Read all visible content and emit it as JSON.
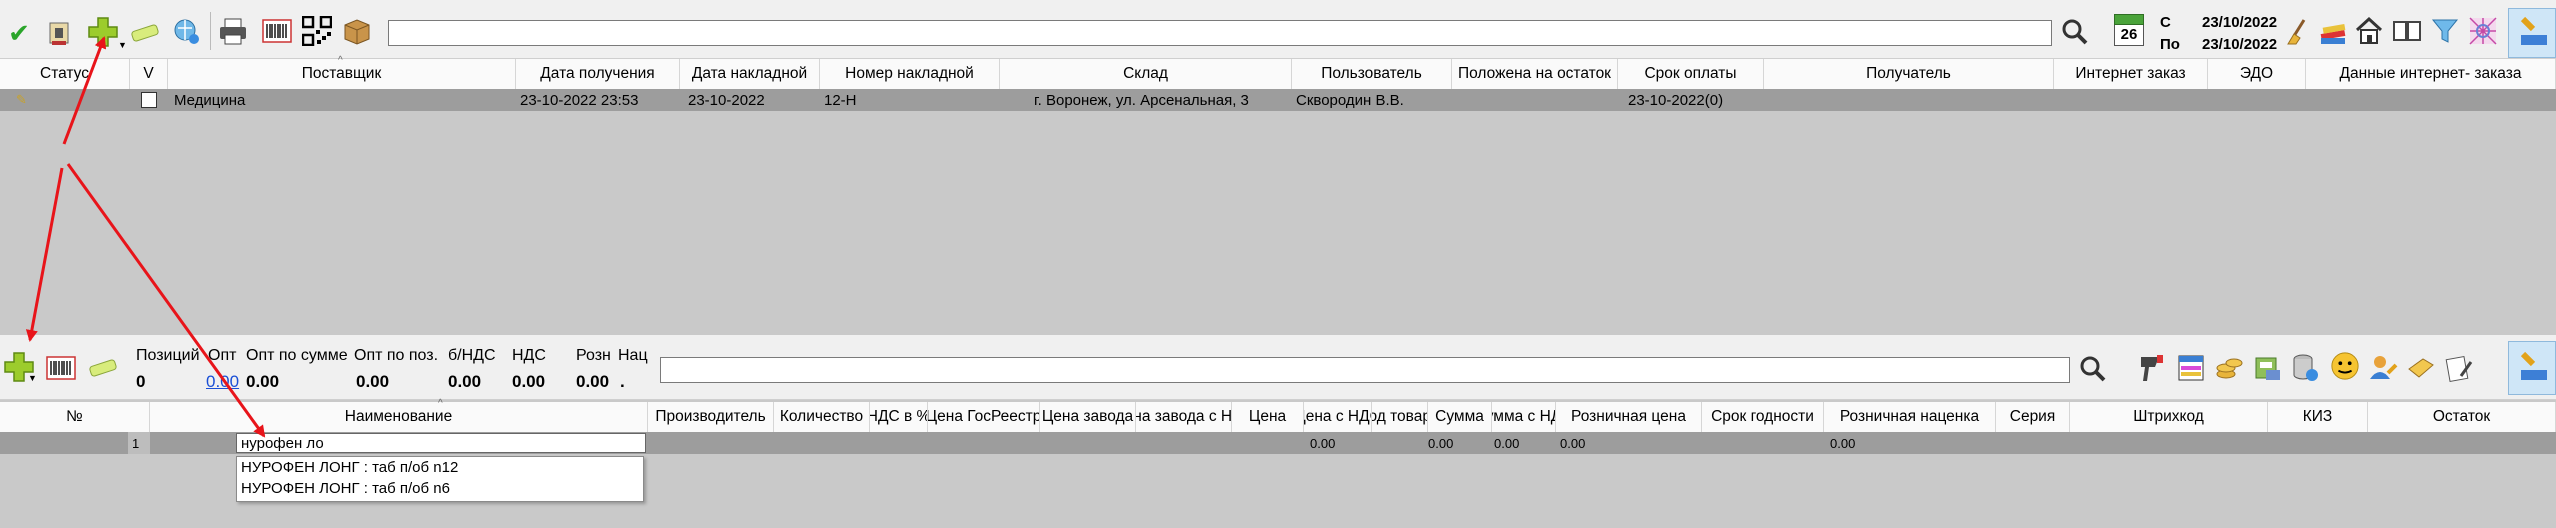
{
  "top_toolbar": {
    "icons": [
      "confirm-check-icon",
      "archive-stamp-icon",
      "add-document-icon",
      "eraser-icon",
      "refresh-globe-icon",
      "print-icon",
      "barcode-icon",
      "qr-code-icon",
      "box-icon"
    ],
    "date_from_label": "С",
    "date_from": "23/10/2022",
    "date_to_label": "По",
    "date_to": "23/10/2022",
    "calendar_day": "26",
    "right_icons": [
      "broom-icon",
      "books-icon",
      "home-icon",
      "book-open-icon",
      "filter-icon",
      "pattern-icon",
      "reports-icon"
    ]
  },
  "invoices_table": {
    "columns": [
      "Статус",
      "V",
      "Поставщик",
      "Дата получения",
      "Дата накладной",
      "Номер накладной",
      "Склад",
      "Пользователь",
      "Положена на остаток",
      "Срок оплаты",
      "Получатель",
      "Интернет заказ",
      "ЭДО",
      "Данные интернет- заказа"
    ],
    "rows": [
      {
        "supplier": "Медицина",
        "received_date": "23-10-2022 23:53",
        "invoice_date": "23-10-2022",
        "invoice_number": "12-Н",
        "warehouse": "г. Воронеж, ул. Арсенальная, 3",
        "user": "Сквородин В.В.",
        "payment_due": "23-10-2022(0)"
      }
    ]
  },
  "summary": {
    "positions_label": "Позиций",
    "positions_value": "0",
    "opt_label": "Опт",
    "opt_value": "0.00",
    "opt_sum_label": "Опт по сумме",
    "opt_sum_value": "0.00",
    "opt_pos_label": "Опт по поз.",
    "opt_pos_value": "0.00",
    "no_vat_label": "б/НДС",
    "no_vat_value": "0.00",
    "vat_label": "НДС",
    "vat_value": "0.00",
    "retail_label": "Розн",
    "retail_value": "0.00",
    "markup_label": "Нац",
    "markup_value": "."
  },
  "positions_table": {
    "columns": [
      "№",
      "Наименование",
      "Производитель",
      "Количество",
      "НДС в %",
      "Цена ГосРеестр",
      "Цена завода",
      "Цена завода с НДС",
      "Цена",
      "Цена с НДС",
      "Код товара",
      "Сумма",
      "Сумма с НДС",
      "Розничная цена",
      "Срок годности",
      "Розничная наценка",
      "Серия",
      "Штрихкод",
      "КИЗ",
      "Остаток"
    ],
    "row": {
      "number": "1",
      "name_input": "нурофен ло",
      "price": "0.00",
      "sum": "0.00",
      "sum_vat": "0.00",
      "retail_price": "0.00",
      "retail_markup": "0.00"
    },
    "autocomplete": [
      "НУРОФЕН ЛОНГ : таб п/об n12",
      "НУРОФЕН ЛОНГ : таб п/об n6"
    ]
  },
  "colors": {
    "toolbar_bg": "#f0f0f0",
    "workspace_bg": "#c9c9c9",
    "selected_row_bg": "#9d9d9d",
    "link_blue": "#1a4fd6",
    "arrow_red": "#e8141a"
  }
}
